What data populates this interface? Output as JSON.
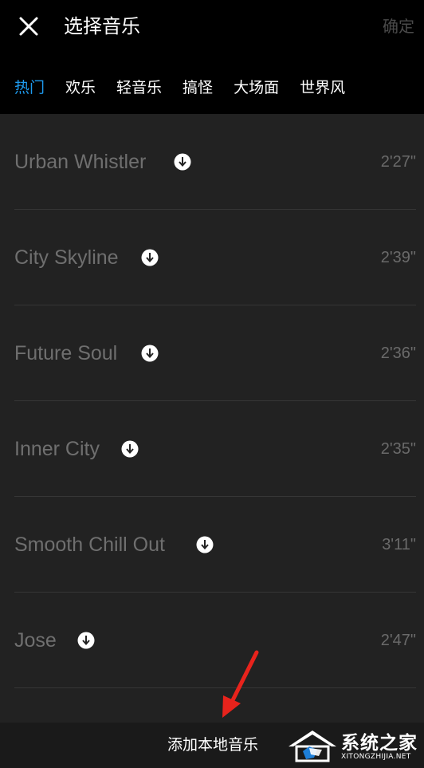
{
  "header": {
    "title": "选择音乐",
    "confirm_label": "确定"
  },
  "tabs": [
    {
      "label": "热门",
      "active": true
    },
    {
      "label": "欢乐",
      "active": false
    },
    {
      "label": "轻音乐",
      "active": false
    },
    {
      "label": "搞怪",
      "active": false
    },
    {
      "label": "大场面",
      "active": false
    },
    {
      "label": "世界风",
      "active": false
    }
  ],
  "tracks": [
    {
      "name": "Urban Whistler",
      "duration": "2'27\""
    },
    {
      "name": "City Skyline",
      "duration": "2'39\""
    },
    {
      "name": "Future Soul",
      "duration": "2'36\""
    },
    {
      "name": "Inner City",
      "duration": "2'35\""
    },
    {
      "name": "Smooth Chill Out",
      "duration": "3'11\""
    },
    {
      "name": "Jose",
      "duration": "2'47\""
    }
  ],
  "bottom": {
    "add_local_label": "添加本地音乐"
  },
  "watermark": {
    "main": "系统之家",
    "sub": "XITONGZHIJIA.NET"
  },
  "colors": {
    "accent": "#1e9bef",
    "annotation_arrow": "#e8231c",
    "list_bg": "#222222",
    "header_bg": "#000000"
  },
  "icons": {
    "close": "close-icon",
    "download": "download-icon",
    "annotation": "red-arrow-annotation"
  }
}
